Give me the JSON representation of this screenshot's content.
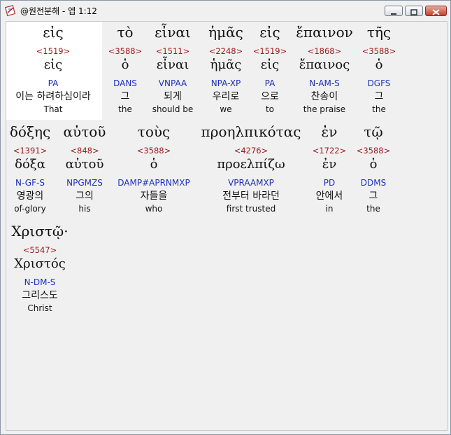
{
  "window": {
    "title": "@원전분해 - 엡 1:12",
    "buttons": [
      "minimize",
      "maximize",
      "close"
    ]
  },
  "colors": {
    "strong": "#9b1a1a",
    "parse": "#1c2fb5"
  },
  "rows": [
    {
      "words": [
        {
          "greek": "εἰς",
          "strong": "<1519>",
          "lemma": "εἰς",
          "parse": "PA",
          "korean": "이는 하려하심이라",
          "english": "That"
        },
        {
          "greek": "τὸ",
          "strong": "<3588>",
          "lemma": "ὁ",
          "parse": "DANS",
          "korean": "그",
          "english": "the"
        },
        {
          "greek": "εἶναι",
          "strong": "<1511>",
          "lemma": "εἶναι",
          "parse": "VNPAA",
          "korean": "되게",
          "english": "should be"
        },
        {
          "greek": "ἡμᾶς",
          "strong": "<2248>",
          "lemma": "ἡμᾶς",
          "parse": "NPA-XP",
          "korean": "우리로",
          "english": "we"
        },
        {
          "greek": "εἰς",
          "strong": "<1519>",
          "lemma": "εἰς",
          "parse": "PA",
          "korean": "으로",
          "english": "to"
        },
        {
          "greek": "ἔπαινον",
          "strong": "<1868>",
          "lemma": "ἔπαινος",
          "parse": "N-AM-S",
          "korean": "찬송이",
          "english": "the praise"
        },
        {
          "greek": "τῆς",
          "strong": "<3588>",
          "lemma": "ὁ",
          "parse": "DGFS",
          "korean": "그",
          "english": "the"
        }
      ]
    },
    {
      "words": [
        {
          "greek": "δόξης",
          "strong": "<1391>",
          "lemma": "δόξα",
          "parse": "N-GF-S",
          "korean": "영광의",
          "english": "of-glory"
        },
        {
          "greek": "αὐτοῦ",
          "strong": "<848>",
          "lemma": "αὐτοῦ",
          "parse": "NPGMZS",
          "korean": "그의",
          "english": "his"
        },
        {
          "greek": "τοὺς",
          "strong": "<3588>",
          "lemma": "ὁ",
          "parse": "DAMP#APRNMXP",
          "korean": "자들을",
          "english": "who"
        },
        {
          "greek": "προηλπικότας",
          "strong": "<4276>",
          "lemma": "προελπίζω",
          "parse": "VPRAAMXP",
          "korean": "전부터 바라던",
          "english": "first trusted"
        },
        {
          "greek": "ἐν",
          "strong": "<1722>",
          "lemma": "ἐν",
          "parse": "PD",
          "korean": "안에서",
          "english": "in"
        },
        {
          "greek": "τῷ",
          "strong": "<3588>",
          "lemma": "ὁ",
          "parse": "DDMS",
          "korean": "그",
          "english": "the"
        }
      ]
    },
    {
      "words": [
        {
          "greek": "Χριστῷ·",
          "strong": "<5547>",
          "lemma": "Χριστός",
          "parse": "N-DM-S",
          "korean": "그리스도",
          "english": "Christ"
        }
      ]
    }
  ]
}
